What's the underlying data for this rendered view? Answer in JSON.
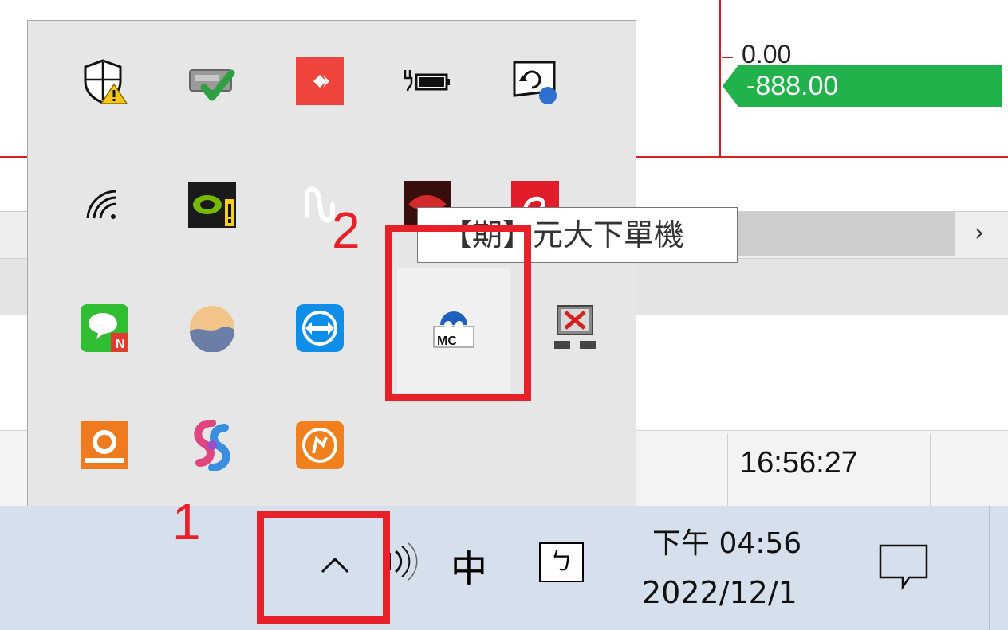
{
  "background_app": {
    "price_top": "0.00",
    "price_flag": "-888.00",
    "status_time": "16:56:27",
    "scroll_right_arrow": "›",
    "colors": {
      "grid_line": "#d42020",
      "price_flag_bg": "#22b24c"
    }
  },
  "tray_popup": {
    "tooltip": "【期】元大下單機",
    "icons": [
      {
        "name": "windows-security-warning-icon"
      },
      {
        "name": "safely-remove-hardware-icon"
      },
      {
        "name": "anydesk-icon"
      },
      {
        "name": "battery-charging-icon"
      },
      {
        "name": "display-settings-icon"
      },
      {
        "name": "wifi-icon"
      },
      {
        "name": "nvidia-warning-icon"
      },
      {
        "name": "audio-wave-icon"
      },
      {
        "name": "red-game-icon"
      },
      {
        "name": "red-brand-icon"
      },
      {
        "name": "line-messenger-icon"
      },
      {
        "name": "weather-icon"
      },
      {
        "name": "teamviewer-icon"
      },
      {
        "name": "yuanta-order-icon"
      },
      {
        "name": "network-disconnected-icon"
      },
      {
        "name": "concords-icon"
      },
      {
        "name": "swirl-app-icon"
      },
      {
        "name": "orange-app-icon"
      }
    ]
  },
  "taskbar": {
    "chevron_label": "^",
    "ime_mode": "中",
    "ime_symbol": "ㄅ",
    "clock_time": "下午 04:56",
    "clock_date": "2022/12/1"
  },
  "annotations": {
    "step_1": "1",
    "step_2": "2",
    "color": "#e8202a"
  }
}
